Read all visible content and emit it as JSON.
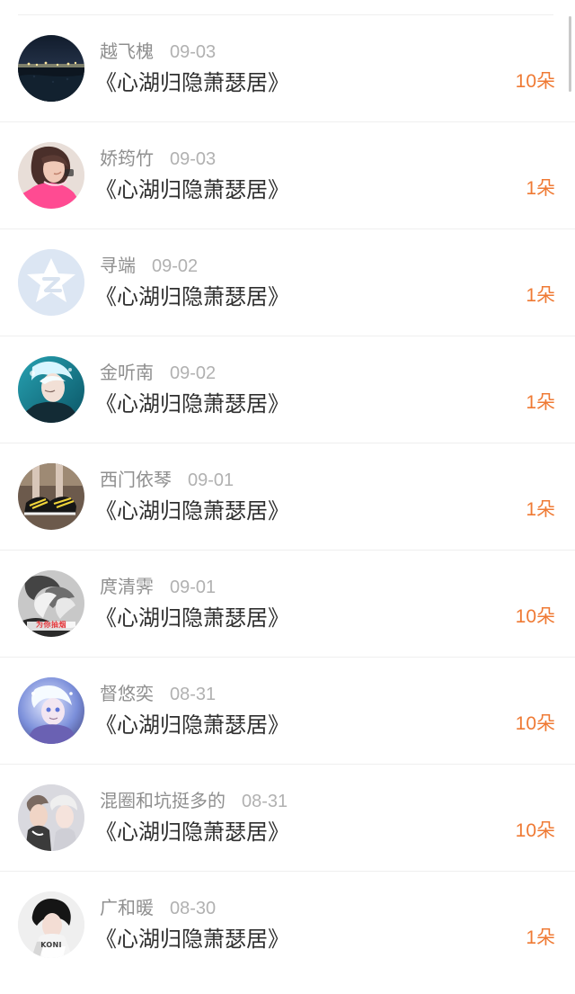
{
  "items": [
    {
      "name": "越飞槐",
      "date": "09-03",
      "title": "《心湖归隐萧瑟居》",
      "amount": "10朵",
      "avatar_icon": "night-city-avatar"
    },
    {
      "name": "娇筠竹",
      "date": "09-03",
      "title": "《心湖归隐萧瑟居》",
      "amount": "1朵",
      "avatar_icon": "girl-pink-avatar"
    },
    {
      "name": "寻端",
      "date": "09-02",
      "title": "《心湖归隐萧瑟居》",
      "amount": "1朵",
      "avatar_icon": "default-star-avatar"
    },
    {
      "name": "金听南",
      "date": "09-02",
      "title": "《心湖归隐萧瑟居》",
      "amount": "1朵",
      "avatar_icon": "anime-boy-avatar"
    },
    {
      "name": "西门依琴",
      "date": "09-01",
      "title": "《心湖归隐萧瑟居》",
      "amount": "1朵",
      "avatar_icon": "sneakers-avatar"
    },
    {
      "name": "庹清霁",
      "date": "09-01",
      "title": "《心湖归隐萧瑟居》",
      "amount": "10朵",
      "avatar_icon": "monochrome-couple-avatar",
      "avatar_caption": "为你抽烟"
    },
    {
      "name": "督悠奕",
      "date": "08-31",
      "title": "《心湖归隐萧瑟居》",
      "amount": "10朵",
      "avatar_icon": "anime-blue-avatar"
    },
    {
      "name": "混圈和坑挺多的",
      "date": "08-31",
      "title": "《心湖归隐萧瑟居》",
      "amount": "10朵",
      "avatar_icon": "game-couple-avatar"
    },
    {
      "name": "广和暖",
      "date": "08-30",
      "title": "《心湖归隐萧瑟居》",
      "amount": "1朵",
      "avatar_icon": "short-hair-avatar",
      "avatar_caption": "KONI"
    }
  ]
}
